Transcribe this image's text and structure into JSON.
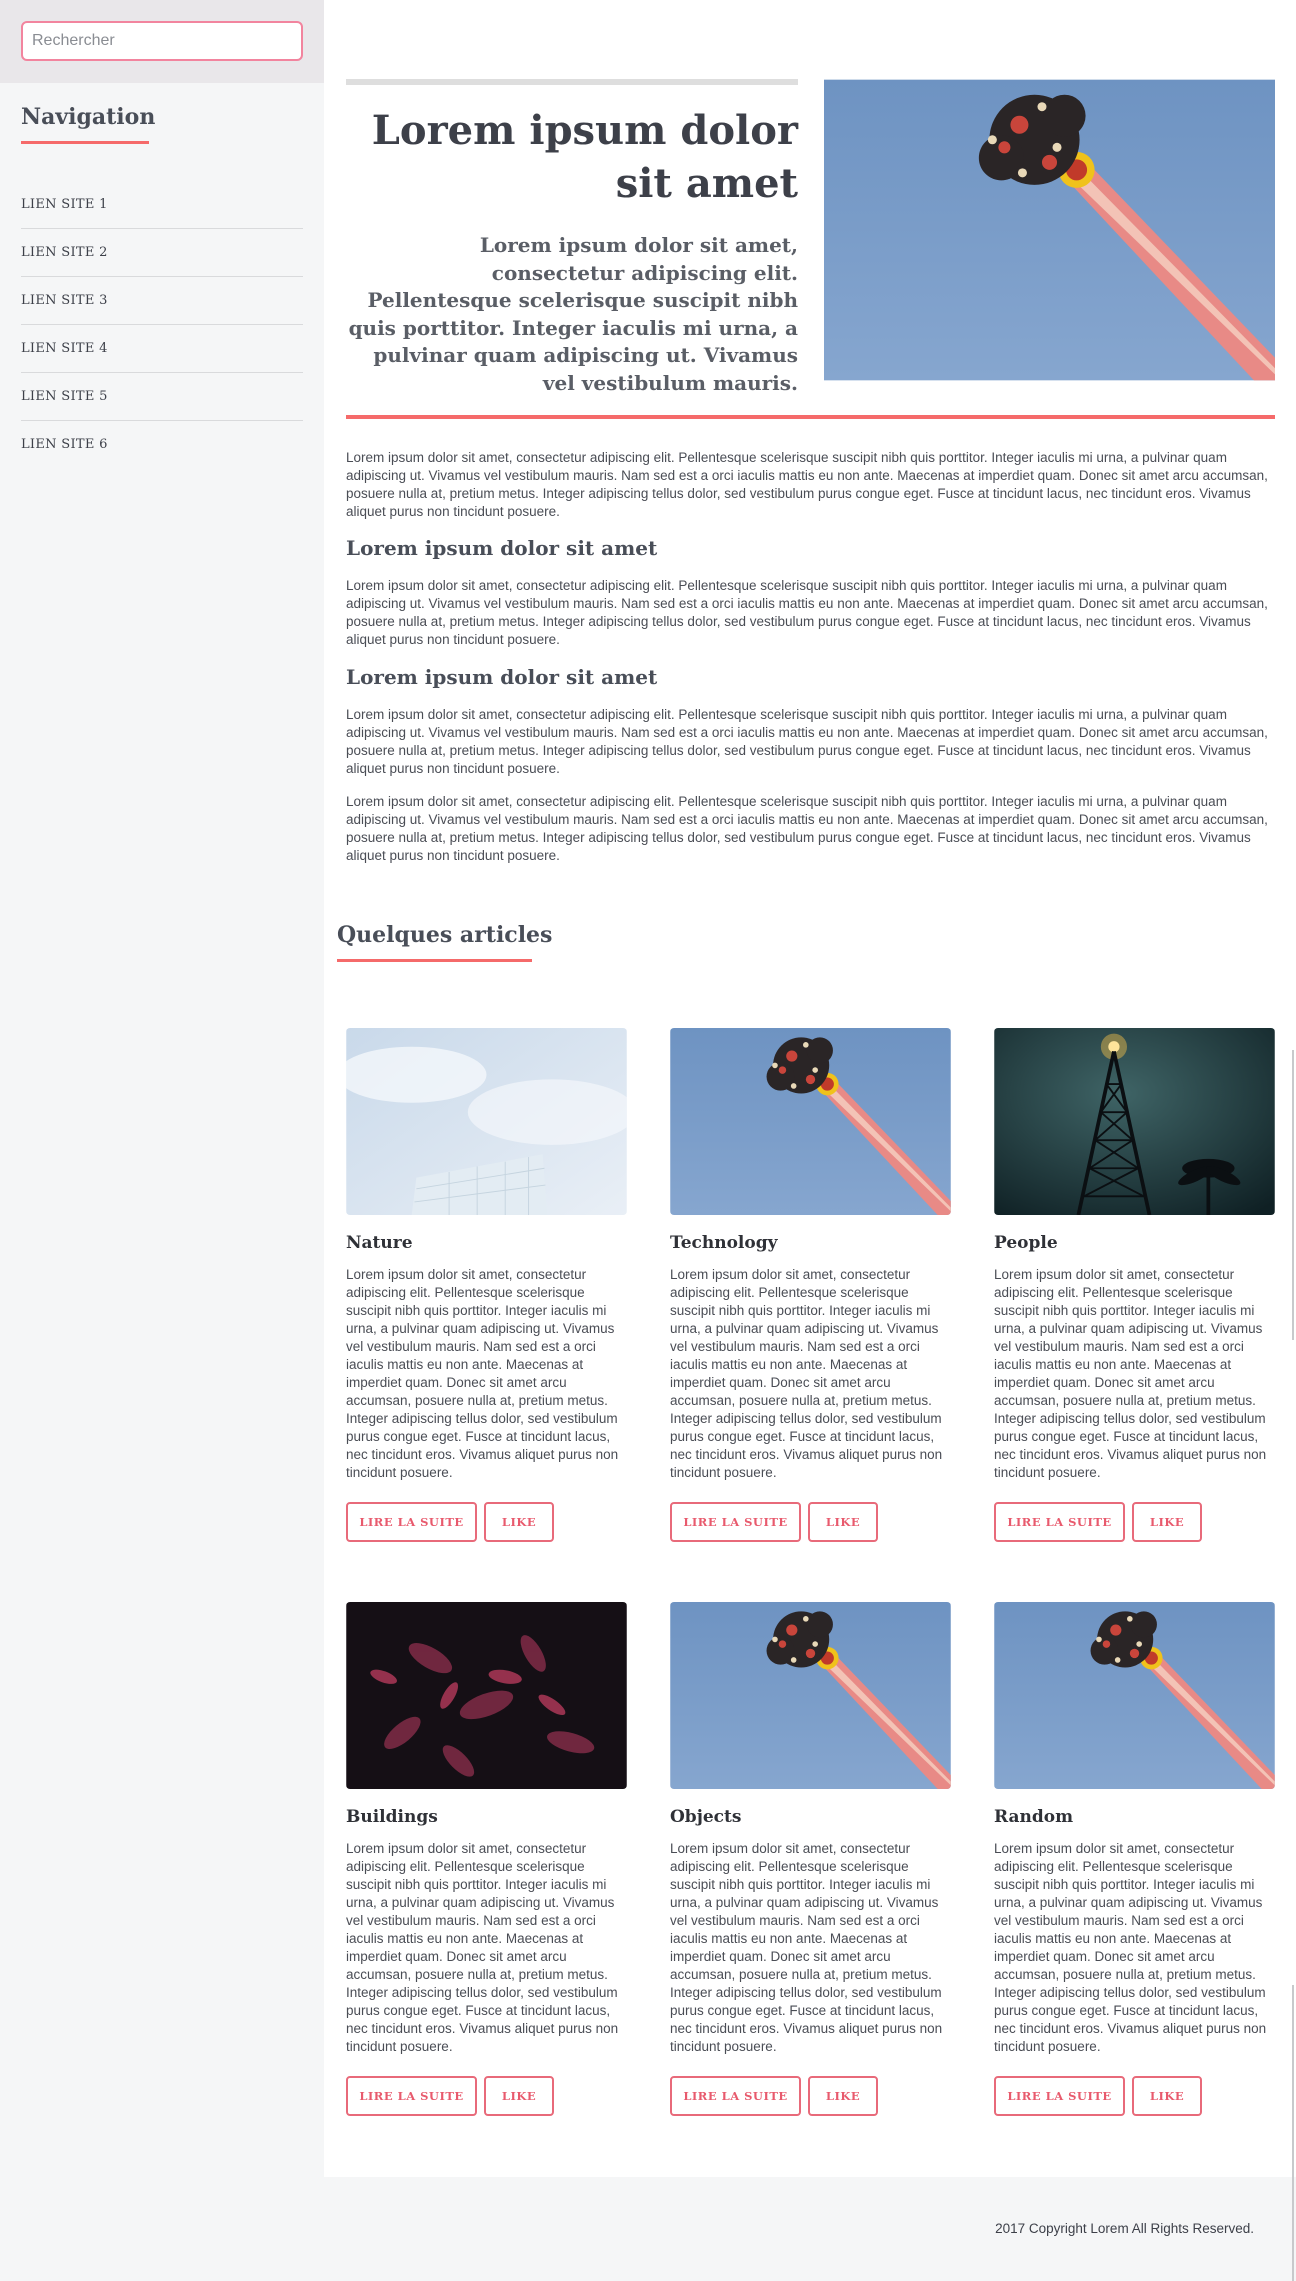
{
  "search": {
    "placeholder": "Rechercher"
  },
  "sidebar": {
    "title": "Navigation",
    "items": [
      {
        "label": "LIEN SITE 1"
      },
      {
        "label": "LIEN SITE 2"
      },
      {
        "label": "LIEN SITE 3"
      },
      {
        "label": "LIEN SITE 4"
      },
      {
        "label": "LIEN SITE 5"
      },
      {
        "label": "LIEN SITE 6"
      }
    ]
  },
  "banner": {
    "title": "Lorem ipsum dolor sit amet",
    "subtitle": "Lorem ipsum dolor sit amet, consectetur adipiscing elit. Pellentesque scelerisque suscipit nibh quis porttitor. Integer iaculis mi urna, a pulvinar quam adipiscing ut. Vivamus vel vestibulum mauris."
  },
  "content": {
    "paragraph_1": "Lorem ipsum dolor sit amet, consectetur adipiscing elit. Pellentesque scelerisque suscipit nibh quis porttitor. Integer iaculis mi urna, a pulvinar quam adipiscing ut. Vivamus vel vestibulum mauris. Nam sed est a orci iaculis mattis eu non ante. Maecenas at imperdiet quam. Donec sit amet arcu accumsan, posuere nulla at, pretium metus. Integer adipiscing tellus dolor, sed vestibulum purus congue eget. Fusce at tincidunt lacus, nec tincidunt eros. Vivamus aliquet purus non tincidunt posuere.",
    "heading_1": "Lorem ipsum dolor sit amet",
    "paragraph_2": "Lorem ipsum dolor sit amet, consectetur adipiscing elit. Pellentesque scelerisque suscipit nibh quis porttitor. Integer iaculis mi urna, a pulvinar quam adipiscing ut. Vivamus vel vestibulum mauris. Nam sed est a orci iaculis mattis eu non ante. Maecenas at imperdiet quam. Donec sit amet arcu accumsan, posuere nulla at, pretium metus. Integer adipiscing tellus dolor, sed vestibulum purus congue eget. Fusce at tincidunt lacus, nec tincidunt eros. Vivamus aliquet purus non tincidunt posuere.",
    "heading_2": "Lorem ipsum dolor sit amet",
    "paragraph_3": "Lorem ipsum dolor sit amet, consectetur adipiscing elit. Pellentesque scelerisque suscipit nibh quis porttitor. Integer iaculis mi urna, a pulvinar quam adipiscing ut. Vivamus vel vestibulum mauris. Nam sed est a orci iaculis mattis eu non ante. Maecenas at imperdiet quam. Donec sit amet arcu accumsan, posuere nulla at, pretium metus. Integer adipiscing tellus dolor, sed vestibulum purus congue eget. Fusce at tincidunt lacus, nec tincidunt eros. Vivamus aliquet purus non tincidunt posuere.",
    "paragraph_4": "Lorem ipsum dolor sit amet, consectetur adipiscing elit. Pellentesque scelerisque suscipit nibh quis porttitor. Integer iaculis mi urna, a pulvinar quam adipiscing ut. Vivamus vel vestibulum mauris. Nam sed est a orci iaculis mattis eu non ante. Maecenas at imperdiet quam. Donec sit amet arcu accumsan, posuere nulla at, pretium metus. Integer adipiscing tellus dolor, sed vestibulum purus congue eget. Fusce at tincidunt lacus, nec tincidunt eros. Vivamus aliquet purus non tincidunt posuere."
  },
  "articles": {
    "title": "Quelques articles",
    "read_label": "LIRE LA SUITE",
    "like_label": "LIKE",
    "items": [
      {
        "title": "Nature",
        "image": "sky-building",
        "text": "Lorem ipsum dolor sit amet, consectetur adipiscing elit. Pellentesque scelerisque suscipit nibh quis porttitor. Integer iaculis mi urna, a pulvinar quam adipiscing ut. Vivamus vel vestibulum mauris. Nam sed est a orci iaculis mattis eu non ante. Maecenas at imperdiet quam. Donec sit amet arcu accumsan, posuere nulla at, pretium metus. Integer adipiscing tellus dolor, sed vestibulum purus congue eget. Fusce at tincidunt lacus, nec tincidunt eros. Vivamus aliquet purus non tincidunt posuere."
      },
      {
        "title": "Technology",
        "image": "amusement-ride",
        "text": "Lorem ipsum dolor sit amet, consectetur adipiscing elit. Pellentesque scelerisque suscipit nibh quis porttitor. Integer iaculis mi urna, a pulvinar quam adipiscing ut. Vivamus vel vestibulum mauris. Nam sed est a orci iaculis mattis eu non ante. Maecenas at imperdiet quam. Donec sit amet arcu accumsan, posuere nulla at, pretium metus. Integer adipiscing tellus dolor, sed vestibulum purus congue eget. Fusce at tincidunt lacus, nec tincidunt eros. Vivamus aliquet purus non tincidunt posuere."
      },
      {
        "title": "People",
        "image": "tower-night",
        "text": "Lorem ipsum dolor sit amet, consectetur adipiscing elit. Pellentesque scelerisque suscipit nibh quis porttitor. Integer iaculis mi urna, a pulvinar quam adipiscing ut. Vivamus vel vestibulum mauris. Nam sed est a orci iaculis mattis eu non ante. Maecenas at imperdiet quam. Donec sit amet arcu accumsan, posuere nulla at, pretium metus. Integer adipiscing tellus dolor, sed vestibulum purus congue eget. Fusce at tincidunt lacus, nec tincidunt eros. Vivamus aliquet purus non tincidunt posuere."
      },
      {
        "title": "Buildings",
        "image": "dark-leaves",
        "text": "Lorem ipsum dolor sit amet, consectetur adipiscing elit. Pellentesque scelerisque suscipit nibh quis porttitor. Integer iaculis mi urna, a pulvinar quam adipiscing ut. Vivamus vel vestibulum mauris. Nam sed est a orci iaculis mattis eu non ante. Maecenas at imperdiet quam. Donec sit amet arcu accumsan, posuere nulla at, pretium metus. Integer adipiscing tellus dolor, sed vestibulum purus congue eget. Fusce at tincidunt lacus, nec tincidunt eros. Vivamus aliquet purus non tincidunt posuere."
      },
      {
        "title": "Objects",
        "image": "amusement-ride",
        "text": "Lorem ipsum dolor sit amet, consectetur adipiscing elit. Pellentesque scelerisque suscipit nibh quis porttitor. Integer iaculis mi urna, a pulvinar quam adipiscing ut. Vivamus vel vestibulum mauris. Nam sed est a orci iaculis mattis eu non ante. Maecenas at imperdiet quam. Donec sit amet arcu accumsan, posuere nulla at, pretium metus. Integer adipiscing tellus dolor, sed vestibulum purus congue eget. Fusce at tincidunt lacus, nec tincidunt eros. Vivamus aliquet purus non tincidunt posuere."
      },
      {
        "title": "Random",
        "image": "amusement-ride",
        "text": "Lorem ipsum dolor sit amet, consectetur adipiscing elit. Pellentesque scelerisque suscipit nibh quis porttitor. Integer iaculis mi urna, a pulvinar quam adipiscing ut. Vivamus vel vestibulum mauris. Nam sed est a orci iaculis mattis eu non ante. Maecenas at imperdiet quam. Donec sit amet arcu accumsan, posuere nulla at, pretium metus. Integer adipiscing tellus dolor, sed vestibulum purus congue eget. Fusce at tincidunt lacus, nec tincidunt eros. Vivamus aliquet purus non tincidunt posuere."
      }
    ]
  },
  "footer": {
    "copyright": "2017 Copyright Lorem All Rights Reserved."
  },
  "colors": {
    "accent": "#f56a6a",
    "text": "#494e58",
    "sidebar_bg": "#f5f6f7"
  }
}
